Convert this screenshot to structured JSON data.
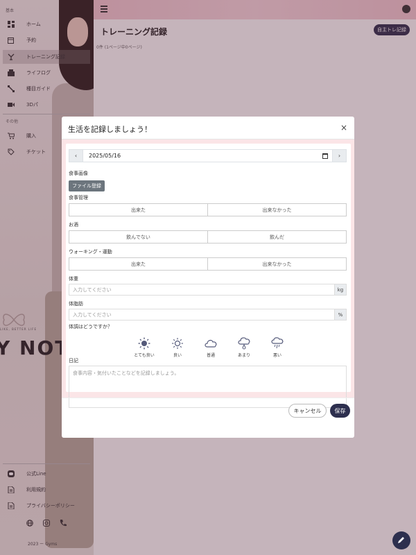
{
  "sidebar": {
    "section_basic": "基本",
    "items": [
      {
        "label": "ホーム",
        "icon": "dashboard-icon"
      },
      {
        "label": "予約",
        "icon": "calendar-edit-icon"
      },
      {
        "label": "トレーニング記録",
        "icon": "dumbbell-icon"
      },
      {
        "label": "ライフログ",
        "icon": "scale-icon"
      },
      {
        "label": "種目ガイド",
        "icon": "fitness-icon"
      },
      {
        "label": "3Dパ",
        "icon": "video-3d-icon"
      }
    ],
    "section_other": "その他",
    "other_items": [
      {
        "label": "購入",
        "icon": "cart-icon"
      },
      {
        "label": "チケット",
        "icon": "tag-icon"
      }
    ],
    "bottom_items": [
      {
        "label": "公式Line",
        "icon": "line-icon"
      },
      {
        "label": "利用規約",
        "icon": "document-icon"
      },
      {
        "label": "プライバシーポリシー",
        "icon": "document-icon"
      }
    ],
    "brand_text": "Y NOT",
    "brand_sub": "LIKE, BETTER LIFE",
    "copyright": "2023 ー  Gyms"
  },
  "header": {
    "page_title": "トレーニング記録",
    "self_training_button": "自主トレ記録",
    "page_count": "0件 (1ページ中0ページ)"
  },
  "modal": {
    "title": "生活を記録しましょう！",
    "close": "×",
    "date_prev": "‹",
    "date_next": "›",
    "date_value": "2025/05/16",
    "meal_image_label": "食事画像",
    "file_button": "ファイル登録",
    "diet_label": "食事管理",
    "diet_options": [
      "出来た",
      "出来なかった"
    ],
    "alcohol_label": "お酒",
    "alcohol_options": [
      "飲んでない",
      "飲んだ"
    ],
    "walking_label": "ウォーキング・運動",
    "walking_options": [
      "出来た",
      "出来なかった"
    ],
    "weight_label": "体重",
    "weight_placeholder": "入力してください",
    "weight_unit": "kg",
    "fat_label": "体脂肪",
    "fat_placeholder": "入力してください",
    "fat_unit": "%",
    "condition_label": "体調はどうですか？",
    "conditions": [
      {
        "label": "とても良い",
        "icon": "sun-filled-icon"
      },
      {
        "label": "良い",
        "icon": "sun-outline-icon"
      },
      {
        "label": "普通",
        "icon": "cloud-icon"
      },
      {
        "label": "あまり",
        "icon": "cloud-drizzle-icon"
      },
      {
        "label": "悪い",
        "icon": "cloud-rain-icon"
      }
    ],
    "diary_label": "日記",
    "diary_placeholder": "食事内容・気付いたことなどを記録しましょう。",
    "cancel_button": "キャンセル",
    "save_button": "保存"
  },
  "colors": {
    "accent": "#2d2f4e",
    "overlay": "#5a283c",
    "modal_body_bg": "#fbe5e7"
  }
}
